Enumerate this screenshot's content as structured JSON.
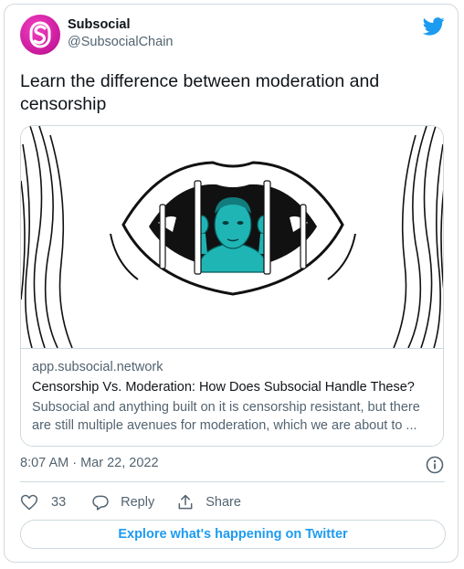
{
  "account": {
    "display_name": "Subsocial",
    "handle": "@SubsocialChain",
    "avatar_color": "#d61ca6"
  },
  "tweet": {
    "text": "Learn the difference between moderation and censorship",
    "timestamp": "8:07 AM · Mar 22, 2022"
  },
  "link_card": {
    "image_icon": "mouth-bars-illustration",
    "domain": "app.subsocial.network",
    "title": "Censorship Vs. Moderation: How Does Subsocial Handle These?",
    "description": "Subsocial and anything built on it is censorship resistant, but there are still multiple avenues for moderation, which we are about to ..."
  },
  "actions": {
    "like_count": "33",
    "reply_label": "Reply",
    "share_label": "Share"
  },
  "footer": {
    "explore_label": "Explore what's happening on Twitter"
  },
  "colors": {
    "twitter_blue": "#1d9bf0",
    "secondary_text": "#536471",
    "border": "#cfd9de",
    "figure_teal": "#1fb5b5"
  }
}
